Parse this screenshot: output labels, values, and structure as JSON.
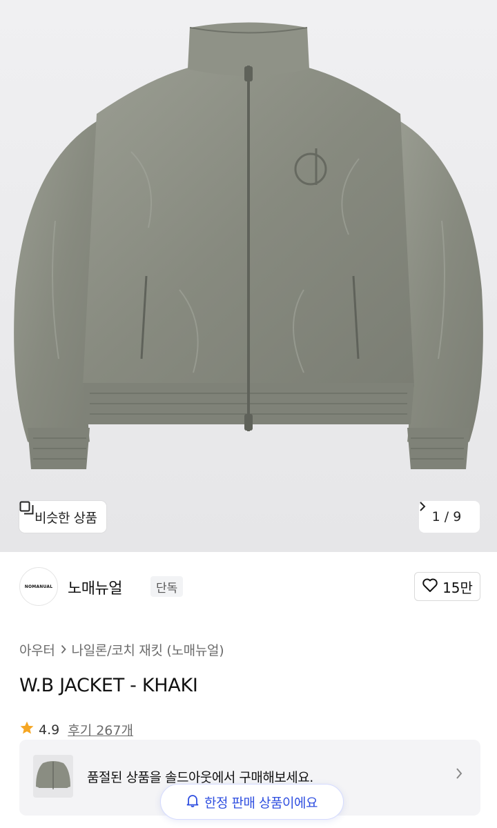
{
  "hero": {
    "similar_label": "비슷한 상품",
    "pager_current": "1",
    "pager_sep": "/",
    "pager_total": "9",
    "pager_text": "1 / 9"
  },
  "brand": {
    "logo_text": "NOMANUAL",
    "name": "노매뉴얼",
    "badge": "단독",
    "likes": "15만"
  },
  "breadcrumb": {
    "category": "아우터",
    "subcategory": "나일론/코치 재킷 (노매뉴얼)"
  },
  "product": {
    "title": "W.B JACKET - KHAKI",
    "rating": "4.9",
    "reviews": "후기 267개"
  },
  "soldout": {
    "message": "품절된 상품을 솔드아웃에서 구매해보세요."
  },
  "toast": {
    "message": "한정 판매 상품이에요"
  },
  "colors": {
    "accent": "#2f4fe0",
    "star": "#f5a623",
    "jacket": "#8a8d82"
  },
  "icons": [
    "similar-icon",
    "chevron-right-icon",
    "heart-icon",
    "star-icon",
    "bell-icon"
  ]
}
